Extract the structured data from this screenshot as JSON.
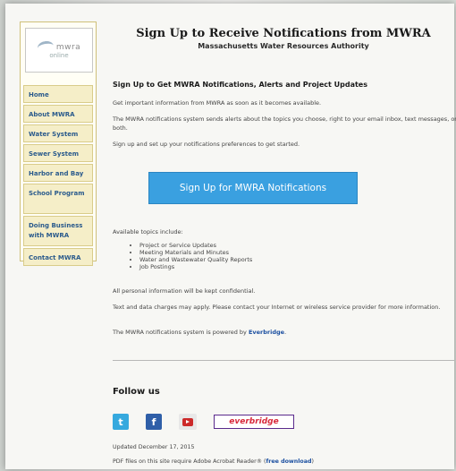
{
  "logo": {
    "name": "mwra",
    "sub": "online"
  },
  "nav": {
    "items": [
      {
        "label": "Home"
      },
      {
        "label": "About MWRA"
      },
      {
        "label": "Water System"
      },
      {
        "label": "Sewer System"
      },
      {
        "label": "Harbor and Bay"
      },
      {
        "label": "School Program"
      },
      {
        "label": "Doing Business with MWRA"
      },
      {
        "label": "Contact MWRA"
      }
    ]
  },
  "header": {
    "title": "Sign Up to Receive Notifications from MWRA",
    "subtitle": "Massachusetts Water Resources Authority"
  },
  "content": {
    "section_heading": "Sign Up to Get MWRA Notifications, Alerts and Project Updates",
    "para1": "Get important information from MWRA as soon as it becomes available.",
    "para2": "The MWRA notifications system sends alerts about the topics you choose, right to your email inbox, text messages, or both.",
    "para3": "Sign up and set up your notifications preferences to get started.",
    "cta_label": "Sign Up for MWRA Notifications",
    "topics_intro": "Available topics include:",
    "topics": [
      "Project or Service Updates",
      "Meeting Materials and Minutes",
      "Water and Wastewater Quality Reports",
      "Job Postings"
    ],
    "privacy": "All personal information will be kept confidential.",
    "charges": "Text and data charges may apply. Please contact your Internet or wireless service provider for more information.",
    "powered_prefix": "The MWRA notifications system is powered by ",
    "powered_link": "Everbridge",
    "powered_suffix": "."
  },
  "follow": {
    "heading": "Follow us",
    "twitter_glyph": "t",
    "facebook_glyph": "f",
    "everbridge_badge": "everbridge"
  },
  "footer": {
    "updated": "Updated December 17, 2015",
    "pdf_prefix": "PDF files on this site require Adobe Acrobat Reader® (",
    "pdf_link": "free download",
    "pdf_suffix": ")"
  },
  "colors": {
    "cta_bg": "#3aa0e0",
    "nav_bg": "#f5eec8",
    "nav_text": "#2a5a8c",
    "link": "#1b4fa0"
  }
}
